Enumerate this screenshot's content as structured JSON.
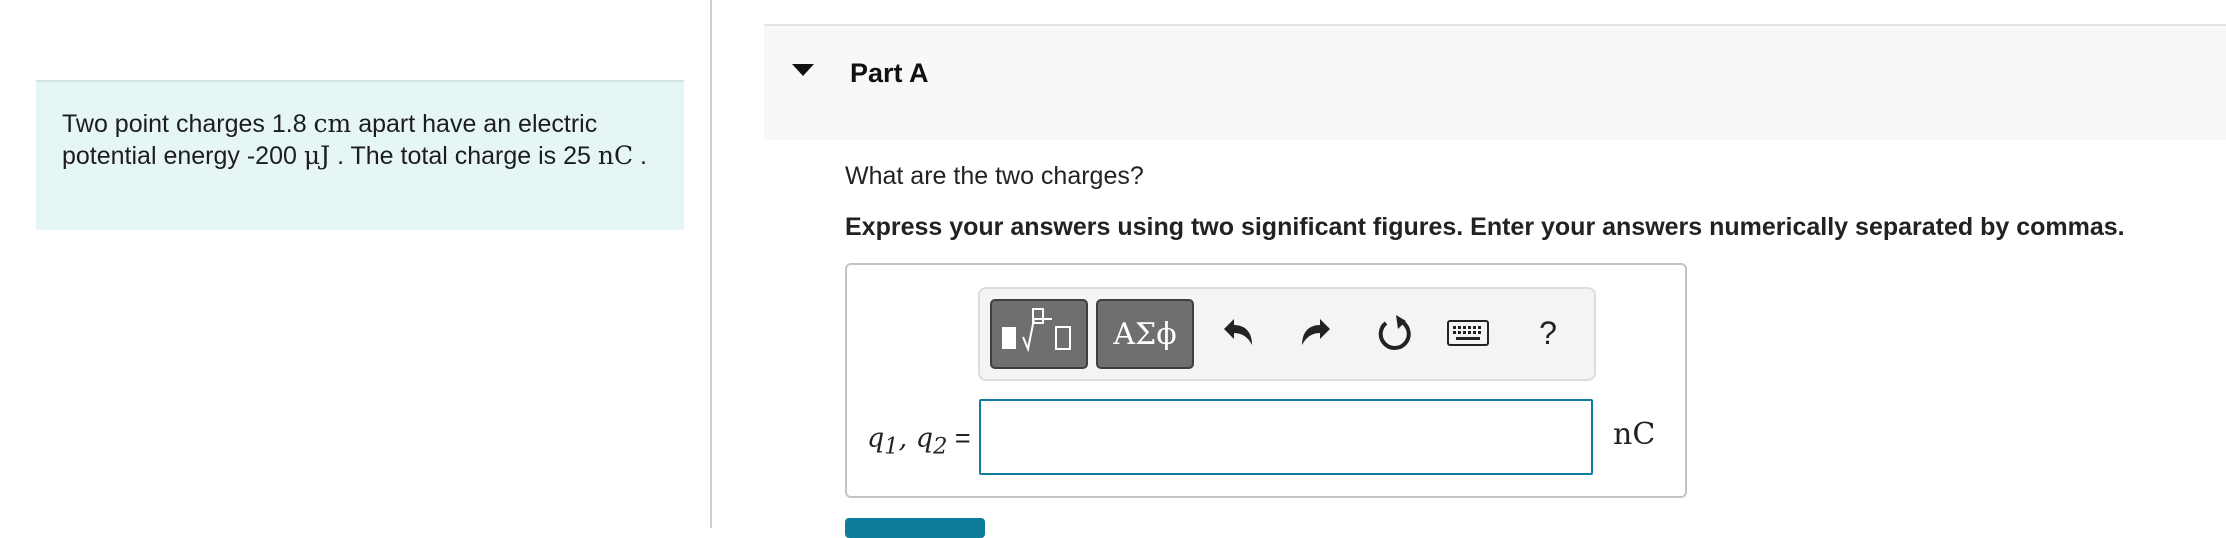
{
  "problem": {
    "seg1": "Two point charges 1.8 ",
    "unit_cm": "cm",
    "seg2": " apart have an electric potential energy -200 ",
    "unit_uj": "μJ",
    "seg3": " . The total charge is 25 ",
    "unit_nc": "nC",
    "seg4": " ."
  },
  "part": {
    "title": "Part A",
    "question": "What are the two charges?",
    "instructions": "Express your answers using two significant figures. Enter your answers numerically separated by commas."
  },
  "toolbar": {
    "greek_label": "ΑΣϕ",
    "help_label": "?",
    "icons": [
      "templates-icon",
      "undo-icon",
      "redo-icon",
      "reset-icon",
      "keyboard-icon"
    ]
  },
  "answer": {
    "label_prefix": "q",
    "sub1": "1",
    "sep": ", q",
    "sub2": "2",
    "equals": " =",
    "value": "",
    "unit": "nC"
  },
  "colors": {
    "problem_bg": "#e6f6f6",
    "accent": "#0f7ea0",
    "toolbar_button": "#6f6f6f"
  }
}
